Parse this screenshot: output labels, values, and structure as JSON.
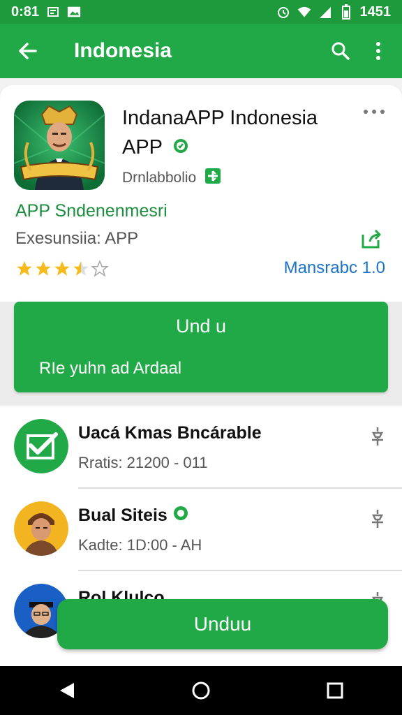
{
  "status_bar": {
    "time": "0:81",
    "right_text": "1451"
  },
  "app_bar": {
    "title": "Indonesia",
    "icons": [
      "back-arrow-icon",
      "search-icon",
      "more-vert-icon"
    ]
  },
  "app": {
    "name_line1": "IndanaAPP Indonesia",
    "name_line2": "APP",
    "developer": "Drnlabbolio",
    "tagline": "APP Sndenenmesri",
    "category": "Exesunsiia: APP",
    "rating_stars": 3.5,
    "rating_max": 5,
    "version": "Mansrabc 1.0"
  },
  "install": {
    "label": "Und u",
    "sub_label": "RIe yuhn ad Ardaal"
  },
  "list": [
    {
      "name": "Uacá Kmas Bncárable",
      "status": "Rratis: 21200 - 011",
      "avatar": "check-icon",
      "verified": false
    },
    {
      "name": "Bual Siteis",
      "status": "Kadte: 1D:00 - AH",
      "avatar": "person-avatar",
      "verified": true
    },
    {
      "name": "Rol Klulco",
      "status": "",
      "avatar": "person-avatar",
      "verified": false
    }
  ],
  "fab": {
    "label": "Unduu"
  },
  "colors": {
    "primary": "#21a847",
    "status_bar": "#1e9a3c",
    "link": "#1a73c9",
    "star": "#f6bb1b"
  }
}
